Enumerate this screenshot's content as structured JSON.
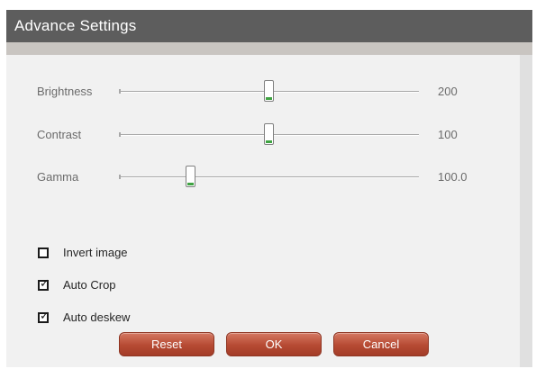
{
  "window": {
    "title": "Advance Settings"
  },
  "sliders": [
    {
      "label": "Brightness",
      "value_text": "200",
      "position": 0.5
    },
    {
      "label": "Contrast",
      "value_text": "100",
      "position": 0.5
    },
    {
      "label": "Gamma",
      "value_text": "100.0",
      "position": 0.24
    }
  ],
  "checkboxes": [
    {
      "label": "Invert image",
      "checked": false
    },
    {
      "label": "Auto Crop",
      "checked": true
    },
    {
      "label": "Auto deskew",
      "checked": true
    }
  ],
  "buttons": {
    "reset": "Reset",
    "ok": "OK",
    "cancel": "Cancel"
  },
  "colors": {
    "title_bar": "#5d5d5d",
    "button": "#b64a33",
    "slider_accent": "#3fa342"
  },
  "icons": {
    "check": "check-mark-icon"
  }
}
